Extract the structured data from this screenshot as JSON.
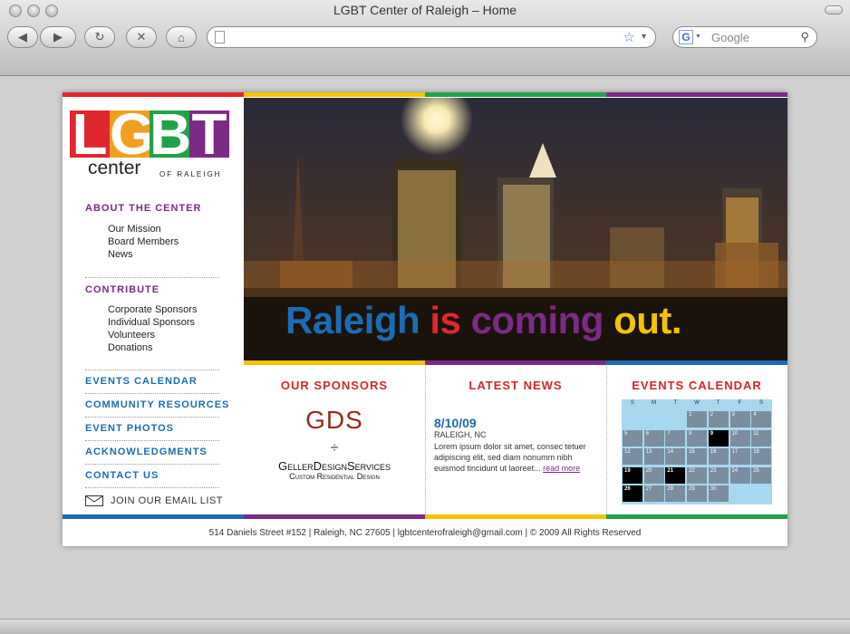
{
  "browser": {
    "window_title": "LGBT Center of Raleigh – Home",
    "search_placeholder": "Google",
    "address_value": ""
  },
  "colors": {
    "red": "#e0262e",
    "yellow": "#f5c400",
    "green": "#1fa348",
    "purple": "#7b2a86",
    "blue": "#1b6cb5",
    "orange": "#f0a020"
  },
  "logo": {
    "letters": [
      "L",
      "G",
      "B",
      "T"
    ],
    "center": "center",
    "of_raleigh": "OF RALEIGH"
  },
  "sidebar": {
    "about": {
      "heading": "ABOUT THE CENTER",
      "items": [
        "Our Mission",
        "Board Members",
        "News"
      ]
    },
    "contribute": {
      "heading": "CONTRIBUTE",
      "items": [
        "Corporate Sponsors",
        "Individual Sponsors",
        "Volunteers",
        "Donations"
      ]
    },
    "links": [
      "EVENTS CALENDAR",
      "COMMUNITY RESOURCES",
      "EVENT PHOTOS",
      "ACKNOWLEDGMENTS",
      "CONTACT US"
    ],
    "email": "JOIN OUR EMAIL LIST"
  },
  "hero": {
    "words": [
      "Raleigh",
      "is",
      "coming",
      "out."
    ]
  },
  "sponsors": {
    "heading": "OUR SPONSORS",
    "logo_mark": "GDS",
    "divider": "÷",
    "name": "GellerDesignServices",
    "tagline": "Custom Residential Design"
  },
  "news": {
    "heading": "LATEST NEWS",
    "date": "8/10/09",
    "location": "RALEIGH, NC",
    "body": "Lorem ipsum dolor sit amet, consec tetuer adipiscing elit, sed diam nonumm nibh euismod tincidunt ut laoreet...",
    "more": "read more"
  },
  "calendar": {
    "heading": "EVENTS CALENDAR",
    "days": [
      "S",
      "M",
      "T",
      "W",
      "T",
      "F",
      "S"
    ],
    "weeks": [
      [
        "",
        "",
        "",
        "1",
        "2",
        "3",
        "4"
      ],
      [
        "5",
        "6",
        "7",
        "8",
        "9",
        "10",
        "11"
      ],
      [
        "12",
        "13",
        "14",
        "15",
        "16",
        "17",
        "18"
      ],
      [
        "19",
        "20",
        "21",
        "22",
        "23",
        "24",
        "25"
      ],
      [
        "26",
        "27",
        "28",
        "29",
        "30",
        "",
        ""
      ]
    ],
    "highlighted": [
      "9",
      "19",
      "21",
      "26"
    ]
  },
  "footer": {
    "text": "514 Daniels Street #152 | Raleigh, NC 27605 | lgbtcenterofraleigh@gmail.com | © 2009 All Rights Reserved"
  }
}
